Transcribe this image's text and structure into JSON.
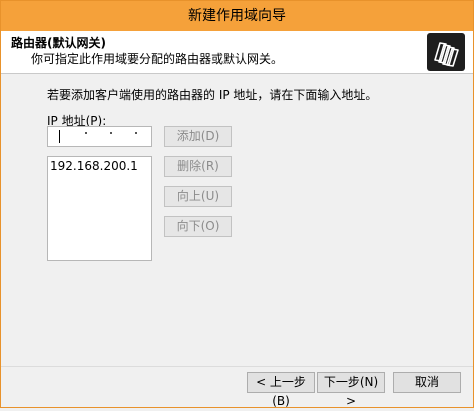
{
  "window": {
    "title": "新建作用域向导"
  },
  "header": {
    "title": "路由器(默认网关)",
    "subtitle": "你可指定此作用域要分配的路由器或默认网关。",
    "icon": "folders-icon"
  },
  "main": {
    "instruction": "若要添加客户端使用的路由器的 IP 地址，请在下面输入地址。",
    "ip_label": "IP 地址(P):",
    "ip_input_value": "",
    "list_items": [
      "192.168.200.1"
    ],
    "buttons": {
      "add": "添加(D)",
      "remove": "删除(R)",
      "up": "向上(U)",
      "down": "向下(O)"
    }
  },
  "footer": {
    "back": "< 上一步(B)",
    "next": "下一步(N) >",
    "cancel": "取消"
  },
  "colors": {
    "titlebar": "#f5a13a",
    "border": "#e8922b",
    "background": "#f0f0f0",
    "disabled_text": "#8c8c8c"
  }
}
